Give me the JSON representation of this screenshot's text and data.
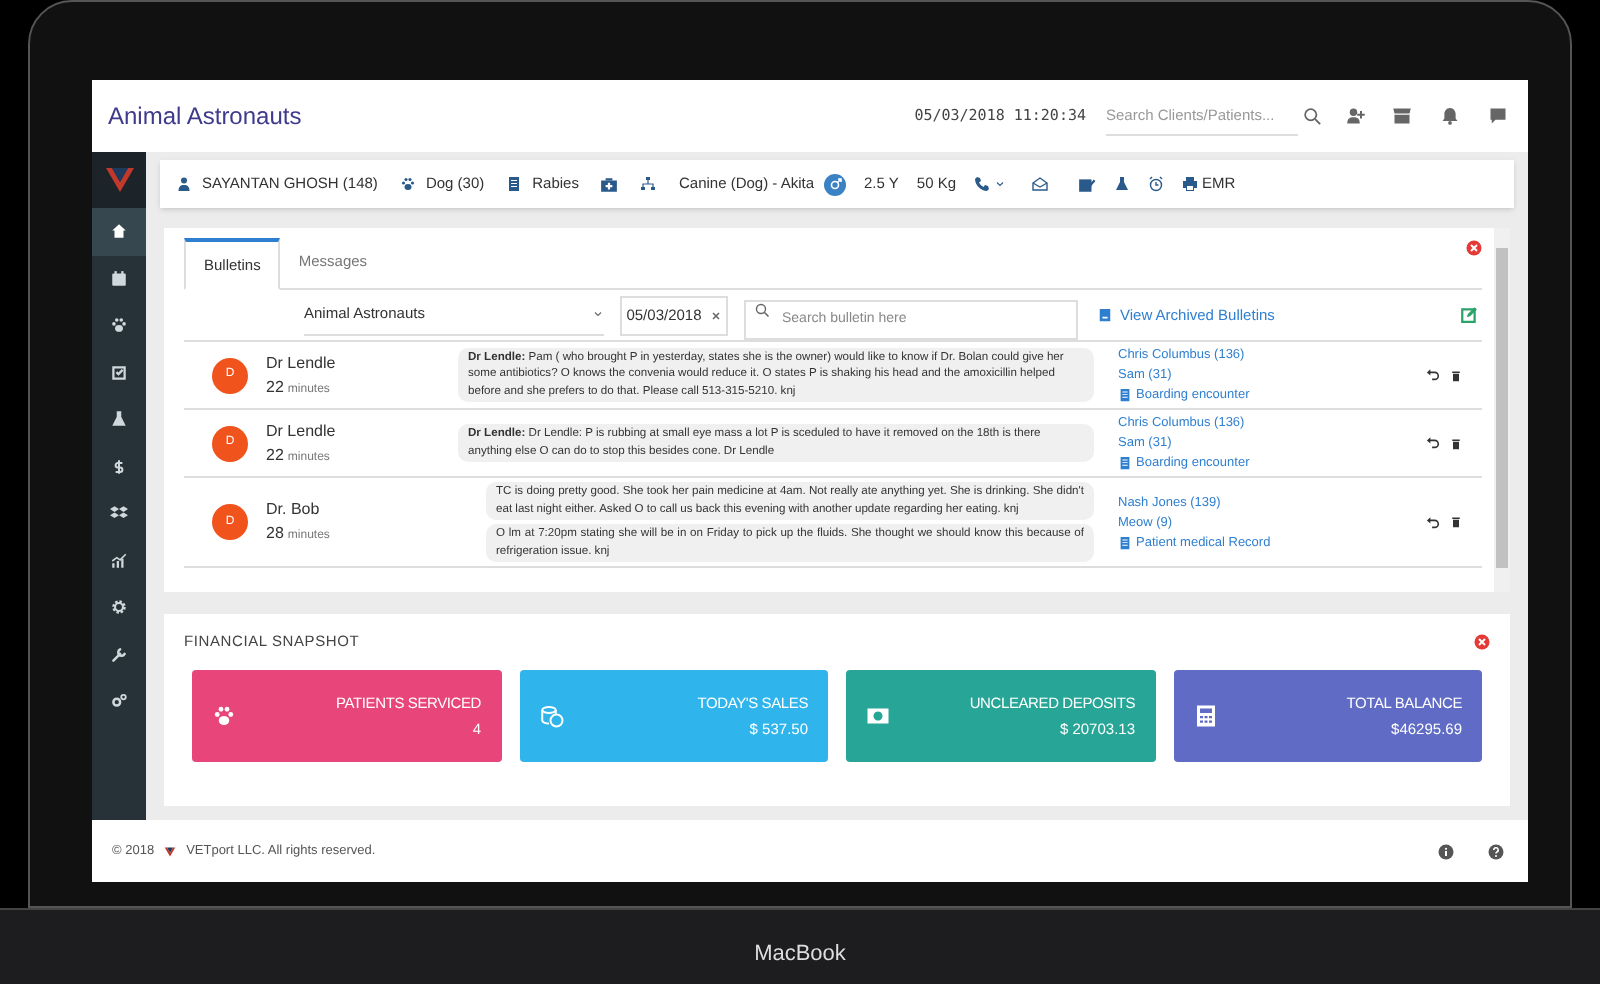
{
  "header": {
    "title": "Animal Astronauts",
    "datetime": "05/03/2018 11:20:34",
    "search": {
      "placeholder": "Search Clients/Patients..."
    }
  },
  "sidebar": {
    "items": [
      {
        "selected": true
      },
      {
        "selected": false
      },
      {
        "selected": false
      },
      {
        "selected": false
      },
      {
        "selected": false
      },
      {
        "selected": false
      },
      {
        "selected": false
      },
      {
        "selected": false
      },
      {
        "selected": false
      },
      {
        "selected": false
      },
      {
        "selected": false
      }
    ]
  },
  "patient_bar": {
    "client": "SAYANTAN GHOSH (148)",
    "patient": "Dog (30)",
    "alert": "Rabies",
    "breed": "Canine (Dog) - Akita",
    "age": "2.5 Y",
    "weight": "50 Kg",
    "emr": "EMR"
  },
  "bulletins": {
    "tabs": [
      {
        "label": "Bulletins",
        "selected": true
      },
      {
        "label": "Messages",
        "selected": false
      }
    ],
    "filters": {
      "clinic": "Animal Astronauts",
      "date": "05/03/2018",
      "search": {
        "placeholder": "Search bulletin here"
      },
      "archived_link": "View Archived Bulletins"
    },
    "rows": [
      {
        "initial": "D",
        "author": "Dr Lendle",
        "elapsed": "22",
        "unit": "minutes",
        "messages": [
          "**Dr Lendle:** Pam ( who brought P in yesterday, states she is the owner) would like to know if Dr. Bolan could give her some antibiotics? O knows the convenia would reduce it. O states P is shaking his head and the amoxicillin helped before and she prefers to do that. Please call 513-315-5210. knj"
        ],
        "links": [
          "Chris Columbus (136)",
          "Sam (31)",
          "Boarding encounter"
        ]
      },
      {
        "initial": "D",
        "author": "Dr Lendle",
        "elapsed": "22",
        "unit": "minutes",
        "messages": [
          "**Dr Lendle:** Dr Lendle: P is rubbing at small eye mass a lot P is sceduled to have it removed on the 18th is there anything else O can do to stop this besides cone. Dr Lendle"
        ],
        "links": [
          "Chris Columbus (136)",
          "Sam (31)",
          "Boarding encounter"
        ]
      },
      {
        "initial": "D",
        "author": "Dr. Bob",
        "elapsed": "28",
        "unit": "minutes",
        "messages": [
          "TC is doing pretty good. She took her pain medicine at 4am. Not really ate anything yet. She is drinking. She didn't eat last night either. Asked O to call us back this evening with another update regarding her eating. knj",
          "O lm at 7:20pm stating she will be in on Friday to pick up the fluids. She thought we should know this because of refrigeration issue. knj"
        ],
        "links": [
          "Nash Jones (139)",
          "Meow (9)",
          "Patient medical Record"
        ]
      }
    ]
  },
  "financial_snapshot": {
    "title": "FINANCIAL SNAPSHOT",
    "cards": [
      {
        "label": "PATIENTS SERVICED",
        "value": "4",
        "color": "#e8457a"
      },
      {
        "label": "TODAY'S SALES",
        "value": "$ 537.50",
        "color": "#2fb5ec"
      },
      {
        "label": "UNCLEARED DEPOSITS",
        "value": "$ 20703.13",
        "color": "#27a697"
      },
      {
        "label": "TOTAL BALANCE",
        "value": "$46295.69",
        "color": "#5f6bc4"
      }
    ]
  },
  "footer": {
    "copyright": "© 2018",
    "company": "VETport LLC. All rights reserved."
  },
  "device": {
    "label": "MacBook"
  }
}
